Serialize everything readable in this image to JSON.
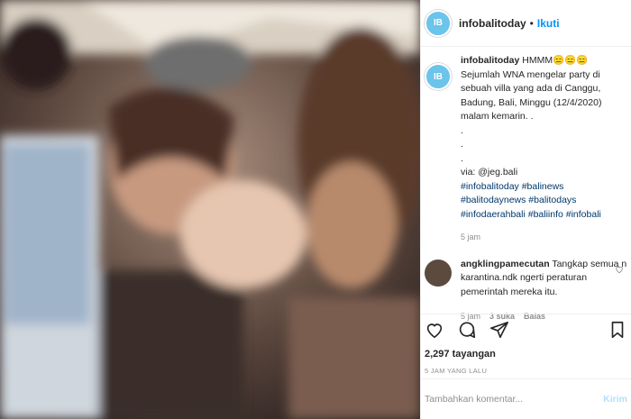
{
  "header": {
    "avatar_initial": "IB",
    "username": "infobalitoday",
    "separator": "•",
    "follow_label": "Ikuti"
  },
  "caption": {
    "username": "infobalitoday",
    "lines": [
      "HMMM😑😑😑",
      "Sejumlah WNA mengelar party di",
      "sebuah villa yang ada di Canggu,",
      "Badung, Bali, Minggu (12/4/2020)",
      "malam kemarin. .",
      ".",
      ".",
      ".",
      "via: @jeg.bali"
    ],
    "hashtag_lines": [
      "#infobalitoday #balinews",
      "#balitodaynews #balitodays",
      "#infodaerahbali #baliinfo #infobali"
    ],
    "time": "5 jam"
  },
  "reply": {
    "username": "angklingpamecutan",
    "text": "Tangkap semua n karantina.ndk ngerti peraturan pemerintah mereka itu.",
    "time": "5 jam",
    "likes": "3 suka",
    "reply_label": "Balas",
    "like_icon": "heart-outline-icon"
  },
  "actions": {
    "icons": [
      "heart-icon",
      "comment-icon",
      "share-icon",
      "bookmark-icon"
    ],
    "views": "2,297 tayangan",
    "date": "5 JAM YANG LALU"
  },
  "add_comment": {
    "placeholder": "Tambahkan komentar...",
    "emoji_icon": "smile-icon",
    "send_label": "Kirim"
  },
  "colors": {
    "link": "#00376b",
    "accent": "#0095f6",
    "muted": "#8e8e8e"
  }
}
